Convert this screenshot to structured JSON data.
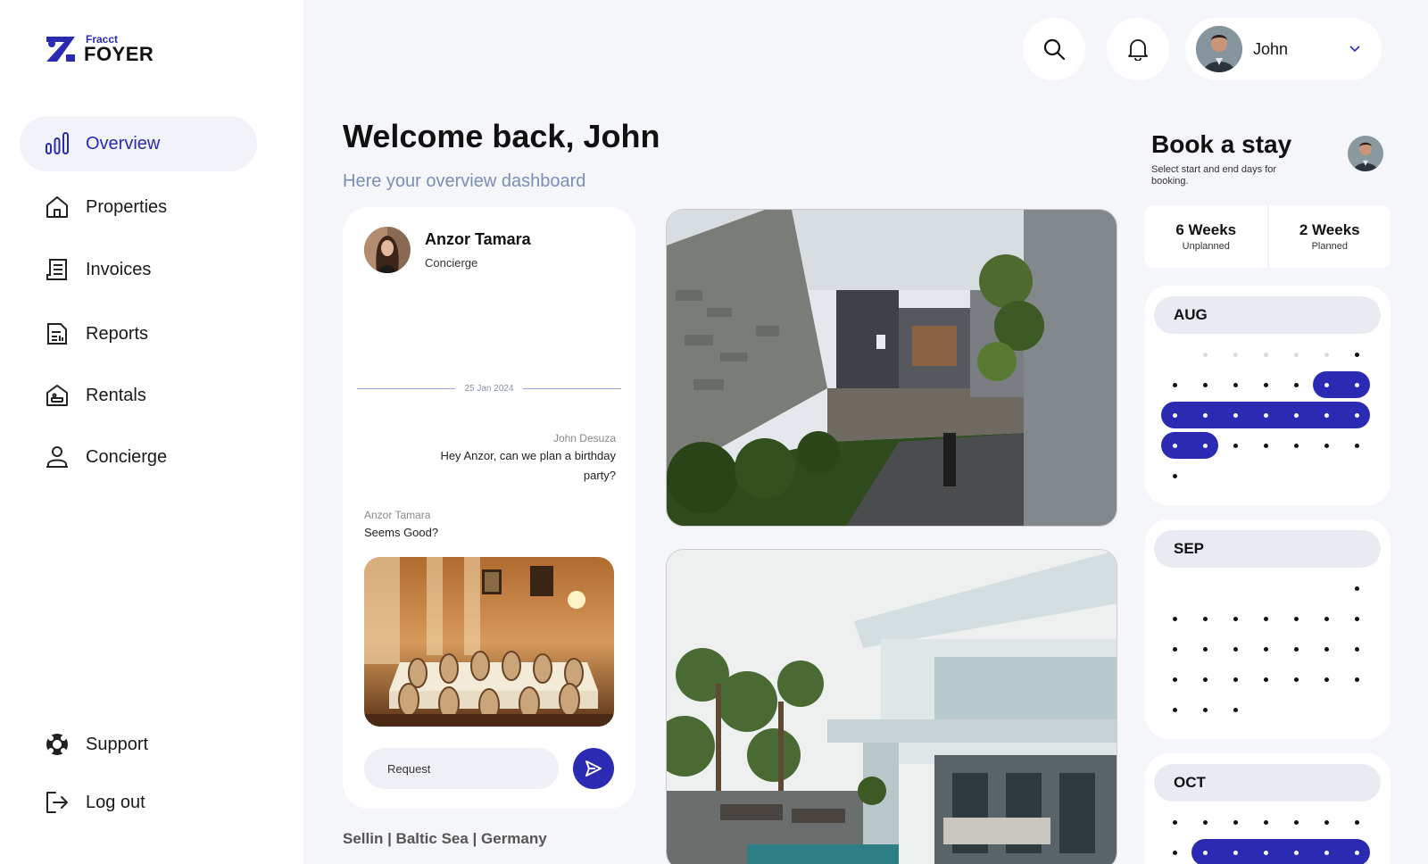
{
  "brand": {
    "small": "Fracct",
    "name": "FOYER"
  },
  "nav": {
    "items": [
      {
        "label": "Overview",
        "icon": "bar-chart-icon",
        "active": true
      },
      {
        "label": "Properties",
        "icon": "home-icon"
      },
      {
        "label": "Invoices",
        "icon": "receipt-icon"
      },
      {
        "label": "Reports",
        "icon": "report-icon"
      },
      {
        "label": "Rentals",
        "icon": "rental-house-icon"
      },
      {
        "label": "Concierge",
        "icon": "person-icon"
      }
    ],
    "bottom": [
      {
        "label": "Support",
        "icon": "lifebuoy-icon"
      },
      {
        "label": "Log out",
        "icon": "logout-icon"
      }
    ]
  },
  "header": {
    "user_name": "John"
  },
  "page": {
    "title": "Welcome back, John",
    "subtitle": "Here your overview dashboard"
  },
  "chat": {
    "contact_name": "Anzor Tamara",
    "contact_role": "Concierge",
    "date": "25 Jan 2024",
    "messages": [
      {
        "author": "John Desuza",
        "text": "Hey Anzor, can we plan a birthday party?"
      },
      {
        "author": "Anzor Tamara",
        "text": "Seems Good?"
      }
    ],
    "input_placeholder": "Request"
  },
  "location": "Sellin | Baltic Sea | Germany",
  "booking": {
    "title": "Book a stay",
    "subtitle": "Select start and end days for booking.",
    "stats": [
      {
        "value": "6 Weeks",
        "label": "Unplanned"
      },
      {
        "value": "2 Weeks",
        "label": "Planned"
      }
    ],
    "months": [
      {
        "name": "AUG",
        "selected_ranges": "Aug 6–7, Aug 8–14, Aug 15–16"
      },
      {
        "name": "SEP"
      },
      {
        "name": "OCT",
        "selected_ranges": "Oct 8–14"
      }
    ]
  },
  "colors": {
    "accent": "#2a2ab3",
    "background": "#f4f6f9",
    "subtitle": "#7c8db5"
  }
}
